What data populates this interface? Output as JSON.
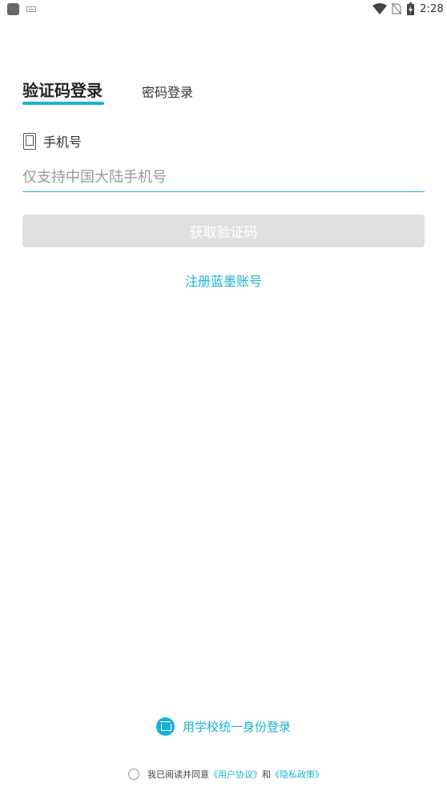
{
  "status_bar": {
    "time": "2:28",
    "icons": [
      "app-icon",
      "keyboard-icon",
      "wifi-icon",
      "no-sim-icon",
      "battery-charging-icon"
    ]
  },
  "tabs": {
    "active_label": "验证码登录",
    "inactive_label": "密码登录"
  },
  "phone": {
    "label": "手机号",
    "icon": "phone-icon",
    "value": "",
    "placeholder": "仅支持中国大陆手机号"
  },
  "actions": {
    "get_code_label": "获取验证码",
    "register_label": "注册蓝墨账号"
  },
  "school_login": {
    "icon": "school-icon",
    "label": "用学校统一身份登录"
  },
  "agreement": {
    "checked": false,
    "prefix": "我已阅读并同意",
    "user_agreement": "《用户协议》",
    "and": "和",
    "privacy_policy": "《隐私政策》"
  },
  "colors": {
    "accent": "#1cb2d1",
    "button_disabled_bg": "#e0e0e0",
    "text": "#222222",
    "placeholder": "#999999"
  }
}
